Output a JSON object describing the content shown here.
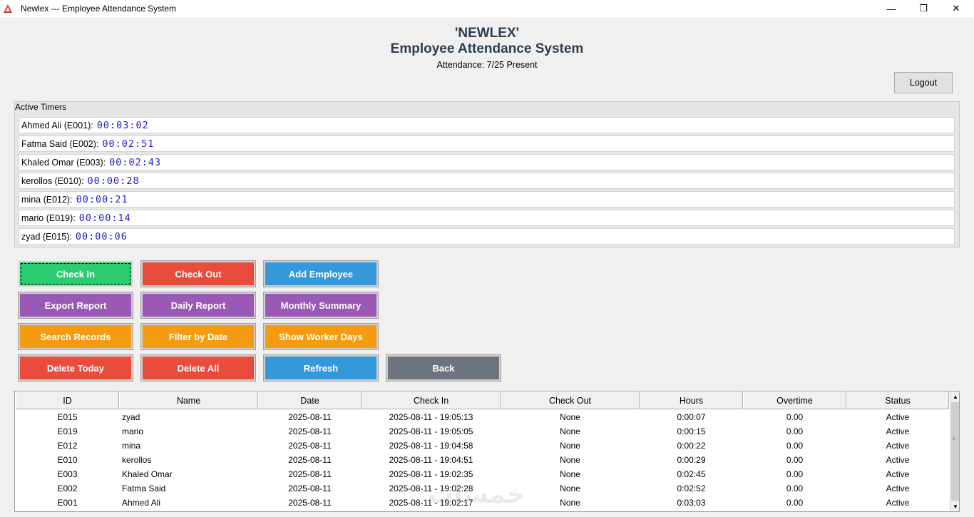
{
  "window": {
    "title": "Newlex --- Employee Attendance System",
    "minimize": "—",
    "maximize": "❐",
    "close": "✕"
  },
  "header": {
    "company": "'NEWLEX'",
    "system": "Employee Attendance System",
    "attendance": "Attendance: 7/25 Present"
  },
  "logout_label": "Logout",
  "timers": {
    "label": "Active Timers",
    "rows": [
      {
        "name": "Ahmed Ali (E001):",
        "time": "00:03:02"
      },
      {
        "name": "Fatma Said (E002):",
        "time": "00:02:51"
      },
      {
        "name": "Khaled Omar (E003):",
        "time": "00:02:43"
      },
      {
        "name": "kerollos (E010):",
        "time": "00:00:28"
      },
      {
        "name": "mina (E012):",
        "time": "00:00:21"
      },
      {
        "name": "mario (E019):",
        "time": "00:00:14"
      },
      {
        "name": "zyad (E015):",
        "time": "00:00:06"
      }
    ]
  },
  "buttons": {
    "check_in": "Check In",
    "check_out": "Check Out",
    "add_employee": "Add Employee",
    "export_report": "Export Report",
    "daily_report": "Daily Report",
    "monthly_summary": "Monthly Summary",
    "search_records": "Search Records",
    "filter_by_date": "Filter by Date",
    "show_worker_days": "Show Worker Days",
    "delete_today": "Delete Today",
    "delete_all": "Delete All",
    "refresh": "Refresh",
    "back": "Back"
  },
  "colors": {
    "green": "#2ecc71",
    "red": "#e74c3c",
    "blue": "#3498db",
    "purple": "#9b59b6",
    "orange": "#f39c12",
    "gray": "#6c757d",
    "timer_blue": "#1f1fd0",
    "title_dark": "#2c3e50"
  },
  "table": {
    "columns": [
      "ID",
      "Name",
      "Date",
      "Check In",
      "Check Out",
      "Hours",
      "Overtime",
      "Status"
    ],
    "rows": [
      [
        "E015",
        "zyad",
        "2025-08-11",
        "2025-08-11 - 19:05:13",
        "None",
        "0:00:07",
        "0.00",
        "Active"
      ],
      [
        "E019",
        "mario",
        "2025-08-11",
        "2025-08-11 - 19:05:05",
        "None",
        "0:00:15",
        "0.00",
        "Active"
      ],
      [
        "E012",
        "mina",
        "2025-08-11",
        "2025-08-11 - 19:04:58",
        "None",
        "0:00:22",
        "0.00",
        "Active"
      ],
      [
        "E010",
        "kerollos",
        "2025-08-11",
        "2025-08-11 - 19:04:51",
        "None",
        "0:00:29",
        "0.00",
        "Active"
      ],
      [
        "E003",
        "Khaled Omar",
        "2025-08-11",
        "2025-08-11 - 19:02:35",
        "None",
        "0:02:45",
        "0.00",
        "Active"
      ],
      [
        "E002",
        "Fatma Said",
        "2025-08-11",
        "2025-08-11 - 19:02:28",
        "None",
        "0:02:52",
        "0.00",
        "Active"
      ],
      [
        "E001",
        "Ahmed Ali",
        "2025-08-11",
        "2025-08-11 - 19:02:17",
        "None",
        "0:03:03",
        "0.00",
        "Active"
      ]
    ]
  },
  "watermark": "خمسات"
}
